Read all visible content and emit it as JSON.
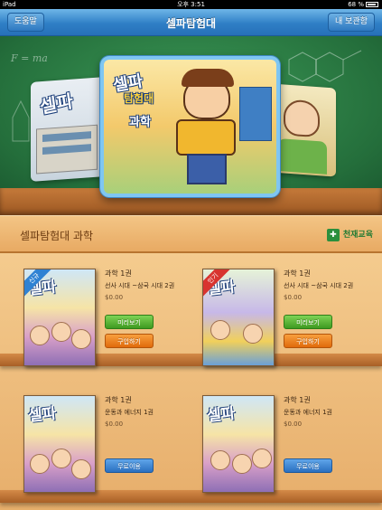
{
  "status_bar": {
    "device": "iPad",
    "time": "오후 3:51",
    "battery": "68 %"
  },
  "navbar": {
    "title": "셀파탐험대",
    "help_label": "도움말",
    "library_label": "내 보관함"
  },
  "board": {
    "chalk_formula": "F = ma"
  },
  "carousel": {
    "left_cover_title": "셀파",
    "main_cover": {
      "title_top": "셀파",
      "title_mid": "탐험대",
      "title_bottom": "과학"
    }
  },
  "section": {
    "title": "셀파탐험대 과학",
    "publisher": "천재교육"
  },
  "books": [
    {
      "thumb_title": "셀파",
      "ribbon": "신규",
      "title": "과학 1권",
      "subtitle": "선사 시대 ~삼국 시대 2권",
      "price": "$0.00",
      "buttons": [
        "미리보기",
        "구입하기"
      ]
    },
    {
      "thumb_title": "셀파",
      "ribbon": "인기",
      "title": "과학 1권",
      "subtitle": "선사 시대 ~삼국 시대 2권",
      "price": "$0.00",
      "buttons": [
        "미리보기",
        "구입하기"
      ]
    },
    {
      "thumb_title": "셀파",
      "ribbon": "",
      "title": "과학 1권",
      "subtitle": "운동과 에너지 1권",
      "price": "$0.00",
      "buttons": [
        "무료이용"
      ]
    },
    {
      "thumb_title": "셀파",
      "ribbon": "",
      "title": "과학 1권",
      "subtitle": "운동과 에너지 1권",
      "price": "$0.00",
      "buttons": [
        "무료이용"
      ]
    }
  ],
  "colors": {
    "navbar": "#2f7fc6",
    "board": "#2e8447",
    "shelf": "#e7ae6b",
    "preview": "#3e9a20",
    "buy": "#e06a0b",
    "free": "#2a6fbf"
  }
}
